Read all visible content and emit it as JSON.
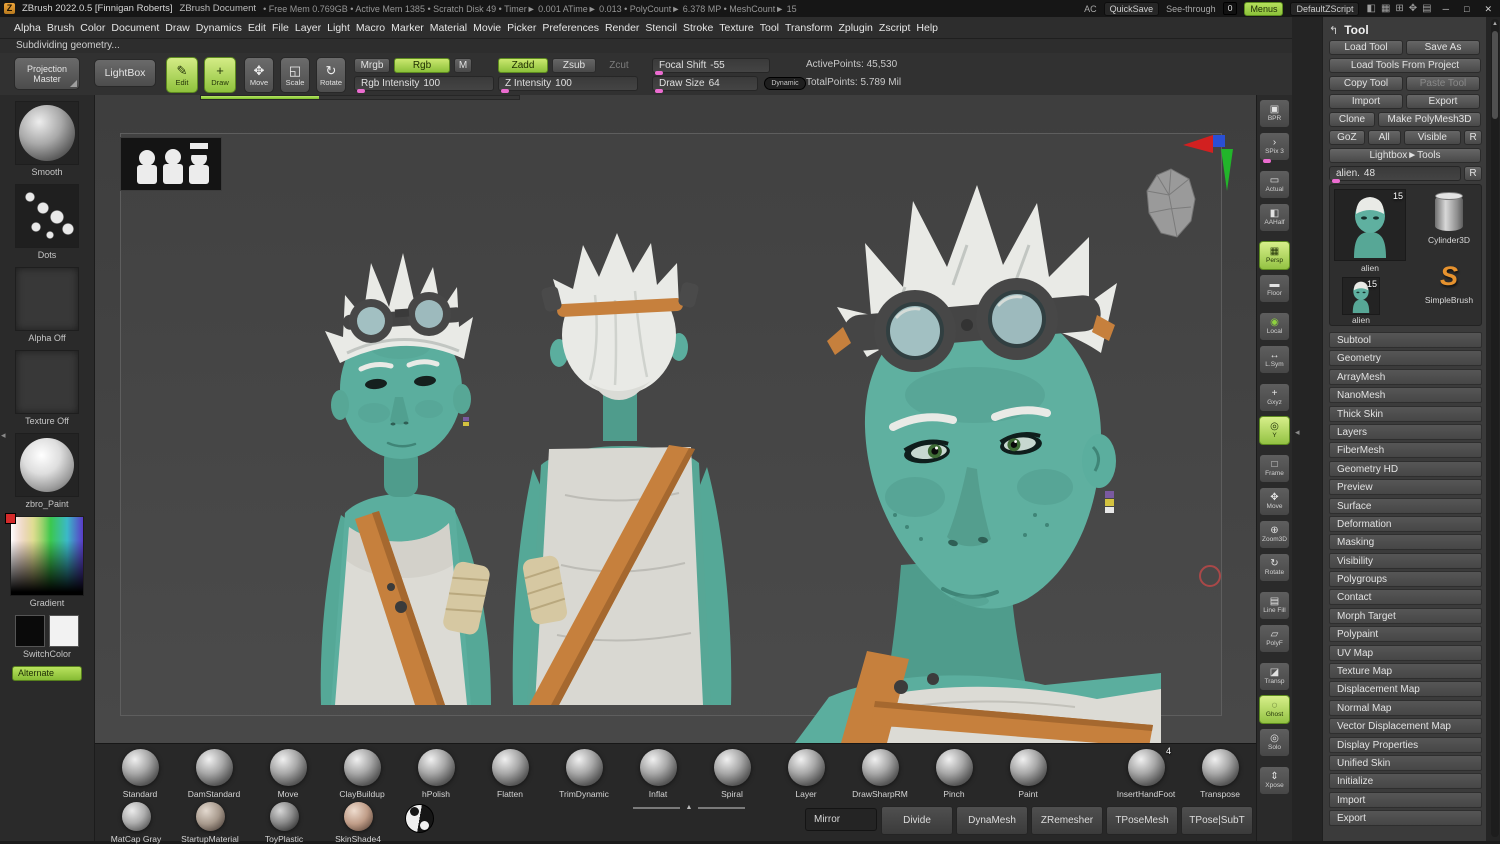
{
  "colors": {
    "accent_green": "#9ccf45",
    "accent_pink": "#ec6cd0",
    "accent_orange": "#c6803d",
    "skin_teal": "#5bae9e",
    "hair_white": "#e9eae6",
    "canvas_gray": "#434343"
  },
  "titlebar": {
    "app_icon": "Z",
    "app_title": "ZBrush 2022.0.5 [Finnigan Roberts]",
    "doc_title": "ZBrush Document",
    "stats": "• Free Mem 0.769GB • Active Mem 1385 • Scratch Disk 49 • Timer► 0.001 ATime► 0.013 • PolyCount► 6.378 MP • MeshCount► 15",
    "ac": "AC",
    "quicksave": "QuickSave",
    "seethrough_label": "See-through",
    "seethrough_value": "0",
    "menus": "Menus",
    "zscript": "DefaultZScript",
    "window_icons": [
      {
        "name": "dock-left",
        "glyph": "◧"
      },
      {
        "name": "grid-layout",
        "glyph": "▦"
      },
      {
        "name": "split-view",
        "glyph": "⊞"
      },
      {
        "name": "move-window",
        "glyph": "✥"
      },
      {
        "name": "rows-layout",
        "glyph": "▤"
      }
    ],
    "minimize": "─",
    "maximize": "□",
    "close": "✕"
  },
  "menubar": [
    "Alpha",
    "Brush",
    "Color",
    "Document",
    "Draw",
    "Dynamics",
    "Edit",
    "File",
    "Layer",
    "Light",
    "Macro",
    "Marker",
    "Material",
    "Movie",
    "Picker",
    "Preferences",
    "Render",
    "Stencil",
    "Stroke",
    "Texture",
    "Tool",
    "Transform",
    "Zplugin",
    "Zscript",
    "Help"
  ],
  "status_message": "Subdividing geometry...",
  "toolbar": {
    "projection_master": "Projection Master",
    "lightbox": "LightBox",
    "edit": "Edit",
    "draw": "Draw",
    "move": "Move",
    "scale": "Scale",
    "rotate": "Rotate",
    "mrgb": "Mrgb",
    "rgb": "Rgb",
    "m": "M",
    "zadd": "Zadd",
    "zsub": "Zsub",
    "zcut": "Zcut",
    "sliders": {
      "rgb_intensity": {
        "label": "Rgb Intensity",
        "value": "100"
      },
      "z_intensity": {
        "label": "Z Intensity",
        "value": "100"
      },
      "focal_shift": {
        "label": "Focal Shift",
        "value": "-55"
      },
      "draw_size": {
        "label": "Draw Size",
        "value": "64"
      }
    },
    "dynamic": "Dynamic",
    "active_points": "ActivePoints: 45,530",
    "total_points": "TotalPoints: 5.789 Mil"
  },
  "icons": {
    "edit": "✎",
    "draw": "+",
    "move": "✥",
    "scale": "◱",
    "rotate": "↻",
    "dock_arrow": "↰",
    "divider_arrow": "◂",
    "scroll_up": "▲",
    "tray_scroll_up": "▲",
    "simplebrush": "S"
  },
  "left_shelf": {
    "stroke_label": "Smooth",
    "dots_label": "Dots",
    "alpha_label": "Alpha Off",
    "texture_label": "Texture Off",
    "material_label": "zbro_Paint",
    "color_picker_label": "Gradient",
    "switch_label": "SwitchColor",
    "alternate_label": "Alternate"
  },
  "canvas": {
    "progress_fraction": 0.37
  },
  "rail": [
    {
      "label": "BPR",
      "glyph": "▣",
      "name": "bpr"
    },
    {
      "label": "SPix 3",
      "glyph": "›",
      "name": "spix",
      "pink": true
    },
    {
      "label": "Actual",
      "glyph": "▭",
      "name": "actual",
      "gap": true
    },
    {
      "label": "AAHalf",
      "glyph": "◧",
      "name": "aahalf"
    },
    {
      "label": "Persp",
      "glyph": "▦",
      "name": "persp",
      "active": true,
      "gap": true
    },
    {
      "label": "Floor",
      "glyph": "▬",
      "name": "floor"
    },
    {
      "label": "Local",
      "glyph": "◉",
      "name": "local",
      "green": true,
      "gap": true
    },
    {
      "label": "L.Sym",
      "glyph": "↔",
      "name": "lsym"
    },
    {
      "label": "Gxyz",
      "glyph": "+",
      "name": "gxyz",
      "gap": true
    },
    {
      "label": "Y",
      "glyph": "◎",
      "name": "y-lock",
      "active": true
    },
    {
      "label": "Frame",
      "glyph": "□",
      "name": "frame",
      "gap": true
    },
    {
      "label": "Move",
      "glyph": "✥",
      "name": "move"
    },
    {
      "label": "Zoom3D",
      "glyph": "⊕",
      "name": "zoom3d"
    },
    {
      "label": "Rotate",
      "glyph": "↻",
      "name": "rotate"
    },
    {
      "label": "Line Fill",
      "glyph": "▤",
      "name": "line-fill",
      "gap": true
    },
    {
      "label": "PolyF",
      "glyph": "▱",
      "name": "polyf"
    },
    {
      "label": "Transp",
      "glyph": "◪",
      "name": "transp",
      "gap": true
    },
    {
      "label": "Ghost",
      "glyph": "◌",
      "name": "ghost",
      "active": true
    },
    {
      "label": "Solo",
      "glyph": "◎",
      "name": "solo"
    },
    {
      "label": "Xpose",
      "glyph": "⇕",
      "name": "xpose",
      "gap": true
    }
  ],
  "tool_panel": {
    "title": "Tool",
    "buttons": {
      "load_tool": "Load Tool",
      "save_as": "Save As",
      "load_from_project": "Load Tools From Project",
      "copy_tool": "Copy Tool",
      "paste_tool": "Paste Tool",
      "import": "Import",
      "export": "Export",
      "clone": "Clone",
      "make_polymesh": "Make PolyMesh3D",
      "goz": "GoZ",
      "all": "All",
      "visible": "Visible",
      "r": "R",
      "lightbox_tools": "Lightbox►Tools",
      "slider_r": "R"
    },
    "slider": {
      "label": "alien.",
      "value": "48"
    },
    "thumbs": {
      "active": {
        "label": "alien",
        "badge": "15"
      },
      "cylinder": {
        "label": "Cylinder3D"
      },
      "simplebrush": {
        "label": "SimpleBrush"
      },
      "recent": {
        "label": "alien",
        "badge": "15"
      }
    },
    "sections": [
      "Subtool",
      "Geometry",
      "ArrayMesh",
      "NanoMesh",
      "Thick Skin",
      "Layers",
      "FiberMesh",
      "Geometry HD",
      "Preview",
      "Surface",
      "Deformation",
      "Masking",
      "Visibility",
      "Polygroups",
      "Contact",
      "Morph Target",
      "Polypaint",
      "UV Map",
      "Texture Map",
      "Displacement Map",
      "Normal Map",
      "Vector Displacement Map",
      "Display Properties",
      "Unified Skin",
      "Initialize",
      "Import",
      "Export"
    ]
  },
  "brush_tray": {
    "brushes": [
      {
        "label": "Standard"
      },
      {
        "label": "DamStandard"
      },
      {
        "label": "Move"
      },
      {
        "label": "ClayBuildup"
      },
      {
        "label": "hPolish"
      },
      {
        "label": "Flatten"
      },
      {
        "label": "TrimDynamic"
      },
      {
        "label": "Inflat"
      },
      {
        "label": "Spiral"
      },
      {
        "label": "Layer"
      },
      {
        "label": "DrawSharpRM"
      },
      {
        "label": "Pinch"
      },
      {
        "label": "Paint"
      },
      {
        "label": "InsertHandFoot",
        "badge": "4",
        "gap": true
      },
      {
        "label": "Transpose"
      }
    ]
  },
  "material_tray": {
    "materials": [
      "MatCap Gray",
      "StartupMaterial",
      "ToyPlastic",
      "SkinShade4"
    ]
  },
  "actions": {
    "mirror": "Mirror",
    "buttons": [
      "Divide",
      "DynaMesh",
      "ZRemesher",
      "TPoseMesh",
      "TPose|SubT"
    ]
  }
}
